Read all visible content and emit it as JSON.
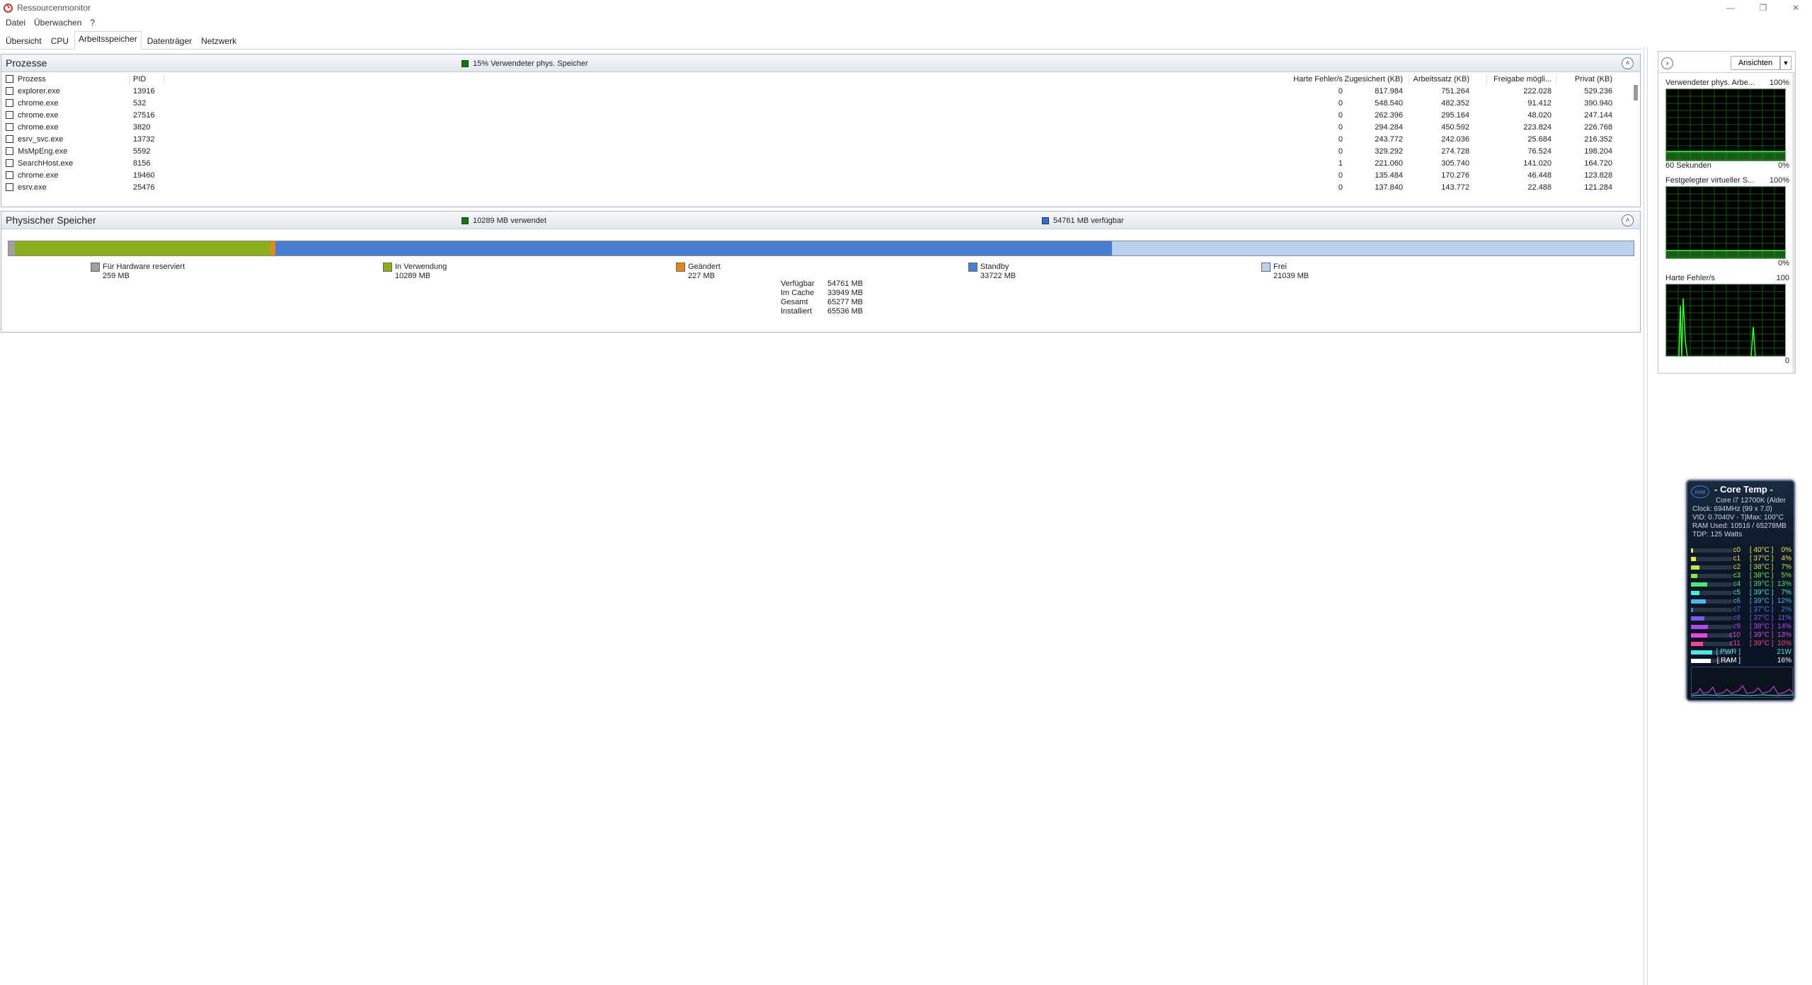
{
  "window": {
    "title": "Ressourcenmonitor",
    "minimize": "—",
    "maximize": "❐",
    "close": "✕"
  },
  "menu": [
    "Datei",
    "Überwachen",
    "?"
  ],
  "tabs": [
    "Übersicht",
    "CPU",
    "Arbeitsspeicher",
    "Datenträger",
    "Netzwerk"
  ],
  "active_tab": "Arbeitsspeicher",
  "processes": {
    "title": "Prozesse",
    "summary": "15% Verwendeter phys. Speicher",
    "summary_color": "#0a7a0a",
    "columns": [
      "Prozess",
      "PID",
      "Harte Fehler/s",
      "Zugesichert (KB)",
      "Arbeitssatz (KB)",
      "Freigabe mögli...",
      "Privat (KB)"
    ],
    "rows": [
      {
        "name": "explorer.exe",
        "pid": "13916",
        "hard": "0",
        "commit": "817.984",
        "ws": "751.264",
        "share": "222.028",
        "priv": "529.236"
      },
      {
        "name": "chrome.exe",
        "pid": "532",
        "hard": "0",
        "commit": "548.540",
        "ws": "482.352",
        "share": "91.412",
        "priv": "390.940"
      },
      {
        "name": "chrome.exe",
        "pid": "27516",
        "hard": "0",
        "commit": "262.396",
        "ws": "295.164",
        "share": "48.020",
        "priv": "247.144"
      },
      {
        "name": "chrome.exe",
        "pid": "3820",
        "hard": "0",
        "commit": "294.284",
        "ws": "450.592",
        "share": "223.824",
        "priv": "226.768"
      },
      {
        "name": "esrv_svc.exe",
        "pid": "13732",
        "hard": "0",
        "commit": "243.772",
        "ws": "242.036",
        "share": "25.684",
        "priv": "216.352"
      },
      {
        "name": "MsMpEng.exe",
        "pid": "5592",
        "hard": "0",
        "commit": "329.292",
        "ws": "274.728",
        "share": "76.524",
        "priv": "198.204"
      },
      {
        "name": "SearchHost.exe",
        "pid": "8156",
        "hard": "1",
        "commit": "221.060",
        "ws": "305.740",
        "share": "141.020",
        "priv": "164.720"
      },
      {
        "name": "chrome.exe",
        "pid": "19460",
        "hard": "0",
        "commit": "135.484",
        "ws": "170.276",
        "share": "46.448",
        "priv": "123.828"
      },
      {
        "name": "esrv.exe",
        "pid": "25476",
        "hard": "0",
        "commit": "137.840",
        "ws": "143.772",
        "share": "22.488",
        "priv": "121.284"
      }
    ]
  },
  "physical": {
    "title": "Physischer Speicher",
    "used_summary": "10289 MB verwendet",
    "available_summary": "54761 MB verfügbar",
    "used_color": "#0a7a0a",
    "available_color": "#2f6fd6",
    "segments": [
      {
        "label": "Für Hardware reserviert",
        "value": "259 MB",
        "mb": 259,
        "color": "#a0a0a0"
      },
      {
        "label": "In Verwendung",
        "value": "10289 MB",
        "mb": 10289,
        "color": "#8cac1c"
      },
      {
        "label": "Geändert",
        "value": "227 MB",
        "mb": 227,
        "color": "#e08a1e"
      },
      {
        "label": "Standby",
        "value": "33722 MB",
        "mb": 33722,
        "color": "#4a7fd0"
      },
      {
        "label": "Frei",
        "value": "21039 MB",
        "mb": 21039,
        "color": "#b9d0ee"
      }
    ],
    "stats": [
      {
        "k": "Verfügbar",
        "v": "54761 MB"
      },
      {
        "k": "Im Cache",
        "v": "33949 MB"
      },
      {
        "k": "Gesamt",
        "v": "65277 MB"
      },
      {
        "k": "Installiert",
        "v": "65536 MB"
      }
    ]
  },
  "right": {
    "views_label": "Ansichten",
    "graphs": [
      {
        "title": "Verwendeter phys. Arbe...",
        "max": "100%",
        "foot_left": "60 Sekunden",
        "foot_right": "0%"
      },
      {
        "title": "Festgelegter virtueller S...",
        "max": "100%",
        "foot_left": "",
        "foot_right": "0%"
      },
      {
        "title": "Harte Fehler/s",
        "max": "100",
        "foot_left": "",
        "foot_right": "0"
      }
    ]
  },
  "coretemp": {
    "logo": "intel",
    "title": "- Core Temp -",
    "lines": [
      "Core i7 12700K (Alder",
      "Clock: 694MHz (99 x 7.0)",
      "VID: 0.7040V - TjMax: 100°C",
      "RAM Used: 10516 / 65278MB",
      "TDP: 125 Watts"
    ],
    "cores": [
      {
        "name": "c0",
        "temp": "[ 40°C ]",
        "load": "0%",
        "color": "#e8e84a",
        "fill": 0.0
      },
      {
        "name": "c1",
        "temp": "[ 37°C ]",
        "load": "4%",
        "color": "#e8e84a",
        "fill": 0.04
      },
      {
        "name": "c2",
        "temp": "[ 38°C ]",
        "load": "7%",
        "color": "#b8e84a",
        "fill": 0.07
      },
      {
        "name": "c3",
        "temp": "[ 38°C ]",
        "load": "5%",
        "color": "#7de84a",
        "fill": 0.05
      },
      {
        "name": "c4",
        "temp": "[ 39°C ]",
        "load": "13%",
        "color": "#4ae87a",
        "fill": 0.13
      },
      {
        "name": "c5",
        "temp": "[ 39°C ]",
        "load": "7%",
        "color": "#4ae8e0",
        "fill": 0.07
      },
      {
        "name": "c6",
        "temp": "[ 39°C ]",
        "load": "12%",
        "color": "#4ab8f0",
        "fill": 0.12
      },
      {
        "name": "c7",
        "temp": "[ 37°C ]",
        "load": "2%",
        "color": "#4a7ff0",
        "fill": 0.02
      },
      {
        "name": "c8",
        "temp": "[ 37°C ]",
        "load": "11%",
        "color": "#7a5af0",
        "fill": 0.11
      },
      {
        "name": "c9",
        "temp": "[ 38°C ]",
        "load": "14%",
        "color": "#b04af0",
        "fill": 0.14
      },
      {
        "name": "c10",
        "temp": "[ 39°C ]",
        "load": "13%",
        "color": "#e04ae0",
        "fill": 0.13
      },
      {
        "name": "c11",
        "temp": "[ 39°C ]",
        "load": "10%",
        "color": "#f04a8a",
        "fill": 0.1
      }
    ],
    "pwr": {
      "name": "[ PWR ]",
      "value": "21W",
      "color": "#4ae8e0",
      "fill": 0.17
    },
    "ram": {
      "name": "[ RAM ]",
      "value": "16%",
      "color": "#ffffff",
      "fill": 0.16
    }
  }
}
